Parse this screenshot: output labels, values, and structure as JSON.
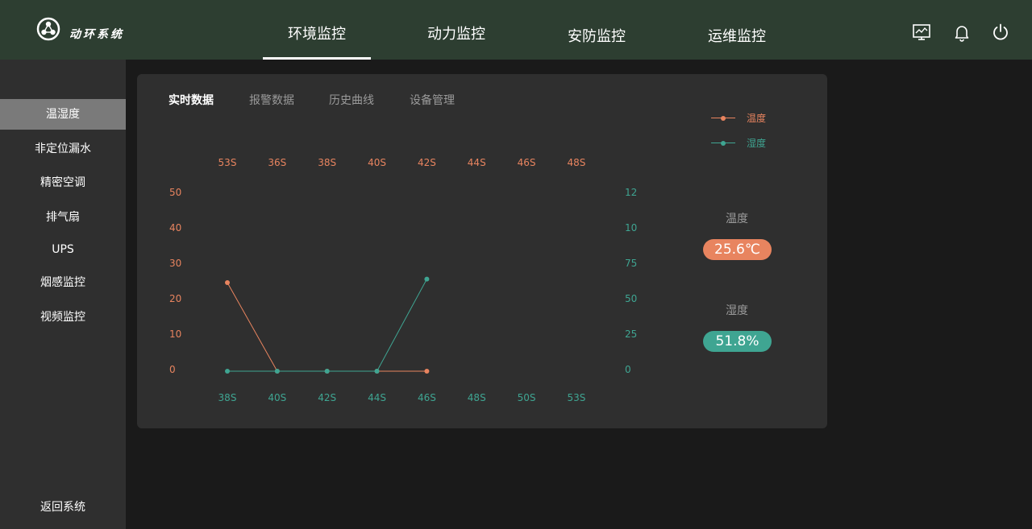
{
  "app": {
    "brand": "动环系统",
    "logo_icon": "network-logo-icon"
  },
  "nav": {
    "tabs": [
      {
        "label": "环境监控",
        "active": true
      },
      {
        "label": "动力监控",
        "active": false
      },
      {
        "label": "安防监控",
        "active": false
      },
      {
        "label": "运维监控",
        "active": false
      }
    ],
    "icons": [
      "monitor-icon",
      "bell-icon",
      "power-icon"
    ]
  },
  "sidebar": {
    "items": [
      {
        "label": "温湿度",
        "active": true
      },
      {
        "label": "非定位漏水",
        "active": false
      },
      {
        "label": "精密空调",
        "active": false
      },
      {
        "label": "排气扇",
        "active": false
      },
      {
        "label": "UPS",
        "active": false
      },
      {
        "label": "烟感监控",
        "active": false
      },
      {
        "label": "视频监控",
        "active": false
      }
    ],
    "back_label": "返回系统"
  },
  "panel": {
    "tabs": [
      {
        "label": "实时数据",
        "active": true
      },
      {
        "label": "报警数据",
        "active": false
      },
      {
        "label": "历史曲线",
        "active": false
      },
      {
        "label": "设备管理",
        "active": false
      }
    ],
    "legend": [
      {
        "label": "温度",
        "color": "#e8845f"
      },
      {
        "label": "湿度",
        "color": "#3fa592"
      }
    ],
    "readings": {
      "temperature_label": "温度",
      "temperature_value": "25.6℃",
      "temperature_color": "#e8845f",
      "humidity_label": "湿度",
      "humidity_value": "51.8%",
      "humidity_color": "#3fa592"
    }
  },
  "chart_data": {
    "type": "line",
    "x_top_ticks": [
      "53S",
      "36S",
      "38S",
      "40S",
      "42S",
      "44S",
      "46S",
      "48S"
    ],
    "x_bottom_ticks": [
      "38S",
      "40S",
      "42S",
      "44S",
      "46S",
      "48S",
      "50S",
      "53S"
    ],
    "y_left_ticks": [
      "50",
      "40",
      "30",
      "20",
      "10",
      "0"
    ],
    "y_right_ticks": [
      "12",
      "10",
      "75",
      "50",
      "25",
      "0"
    ],
    "y_left_range": [
      0,
      50
    ],
    "y_right_range": [
      0,
      125
    ],
    "grid": false,
    "legend_position": "top-right",
    "series": [
      {
        "name": "温度",
        "color": "#e8845f",
        "axis": "top-left",
        "values": [
          25,
          0,
          0,
          0,
          0
        ]
      },
      {
        "name": "湿度",
        "color": "#3fa592",
        "axis": "bottom-right",
        "values": [
          0,
          0,
          0,
          0,
          65
        ]
      }
    ]
  }
}
